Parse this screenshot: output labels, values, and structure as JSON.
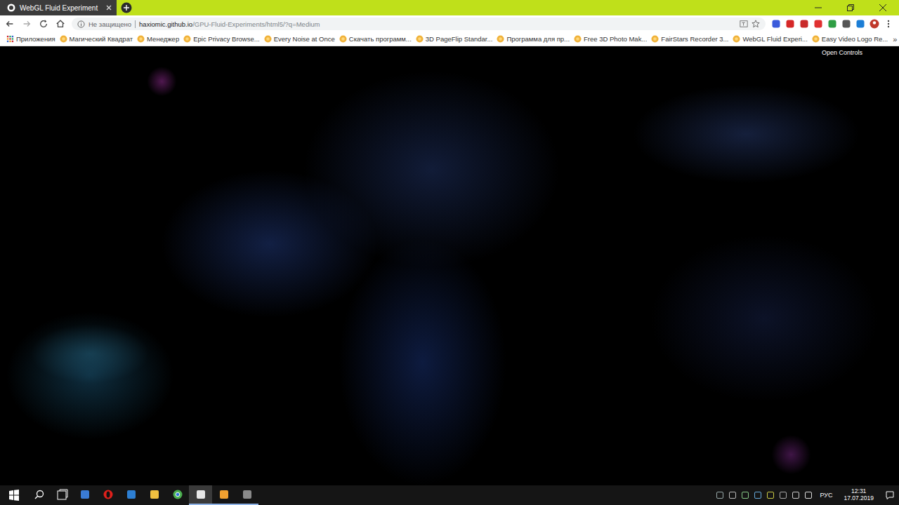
{
  "tabs": [
    {
      "label": "WebGL Fluid Experiment",
      "selected": true
    }
  ],
  "toolbar": {
    "security": "Не защищено",
    "url_host": "haxiomic.github.io",
    "url_path": "/GPU-Fluid-Experiments/html5/?q=Medium"
  },
  "bookmarks": [
    {
      "label": "Приложения",
      "kind": "apps"
    },
    {
      "label": "Магический Квадрат",
      "kind": "site"
    },
    {
      "label": "Менеджер",
      "kind": "site"
    },
    {
      "label": "Epic Privacy Browse...",
      "kind": "site"
    },
    {
      "label": "Every Noise at Once",
      "kind": "site"
    },
    {
      "label": "Скачать программ...",
      "kind": "site"
    },
    {
      "label": "3D PageFlip Standar...",
      "kind": "site"
    },
    {
      "label": "Программа для пр...",
      "kind": "site"
    },
    {
      "label": "Free 3D Photo Mak...",
      "kind": "site"
    },
    {
      "label": "FairStars Recorder 3...",
      "kind": "site"
    },
    {
      "label": "WebGL Fluid Experi...",
      "kind": "site"
    },
    {
      "label": "Easy Video Logo Re...",
      "kind": "site"
    }
  ],
  "bookmarks_overflow": "»",
  "page": {
    "controls_link": "Open Controls"
  },
  "taskbar": {
    "apps": [
      {
        "running": false,
        "selected": false
      },
      {
        "running": false,
        "selected": false
      },
      {
        "running": false,
        "selected": false
      },
      {
        "running": false,
        "selected": false
      },
      {
        "running": false,
        "selected": false
      },
      {
        "running": true,
        "selected": true
      },
      {
        "running": true,
        "selected": false
      },
      {
        "running": true,
        "selected": false
      }
    ],
    "language": "РУС",
    "time": "12:31",
    "date": "17.07.2019"
  }
}
